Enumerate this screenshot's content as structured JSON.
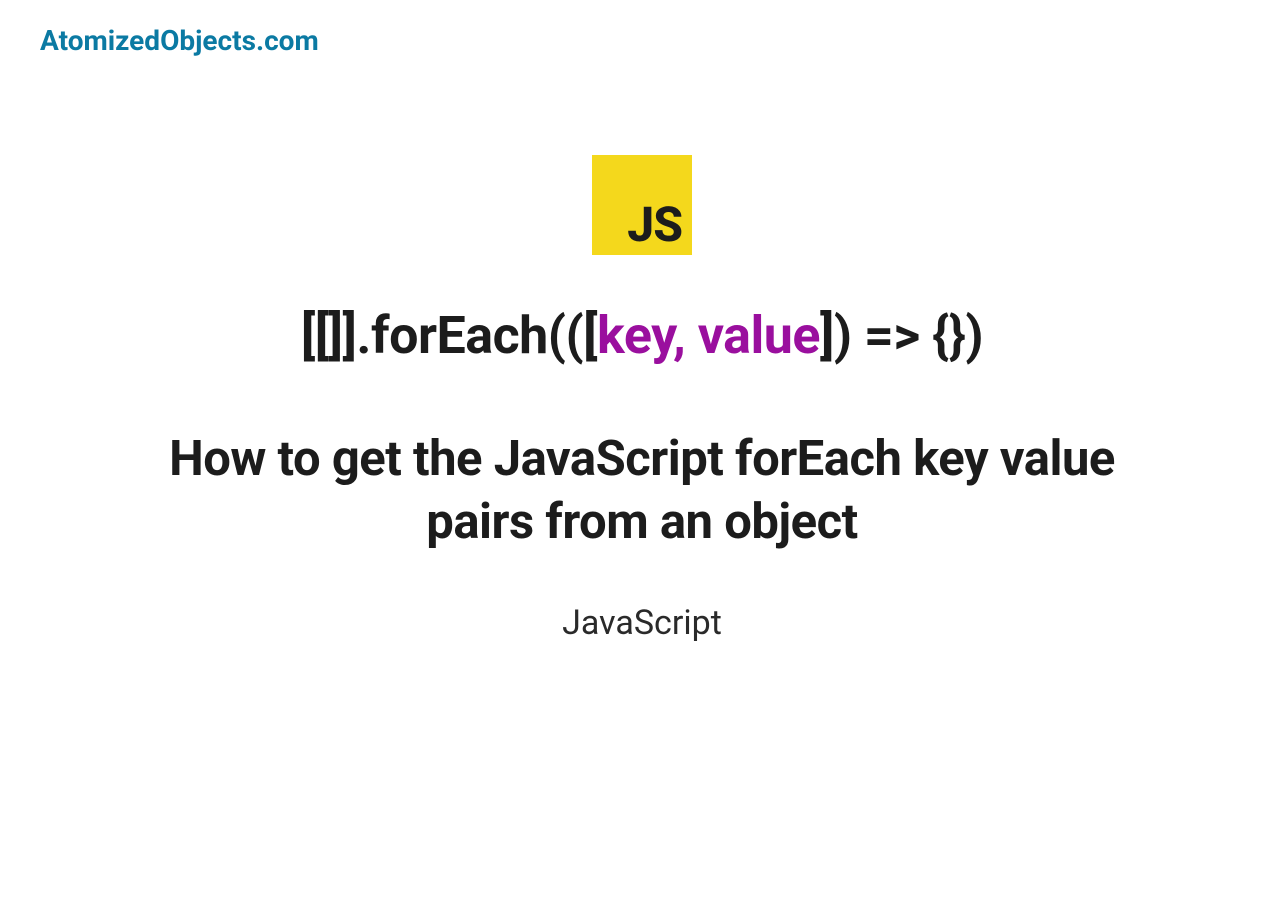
{
  "site": {
    "name": "AtomizedObjects.com"
  },
  "logo": {
    "text": "JS"
  },
  "code": {
    "prefix": "[[]].forEach(([",
    "highlight": "key, value",
    "suffix": "]) => {})"
  },
  "title": "How to get the JavaScript forEach key value pairs from an object",
  "category": "JavaScript"
}
